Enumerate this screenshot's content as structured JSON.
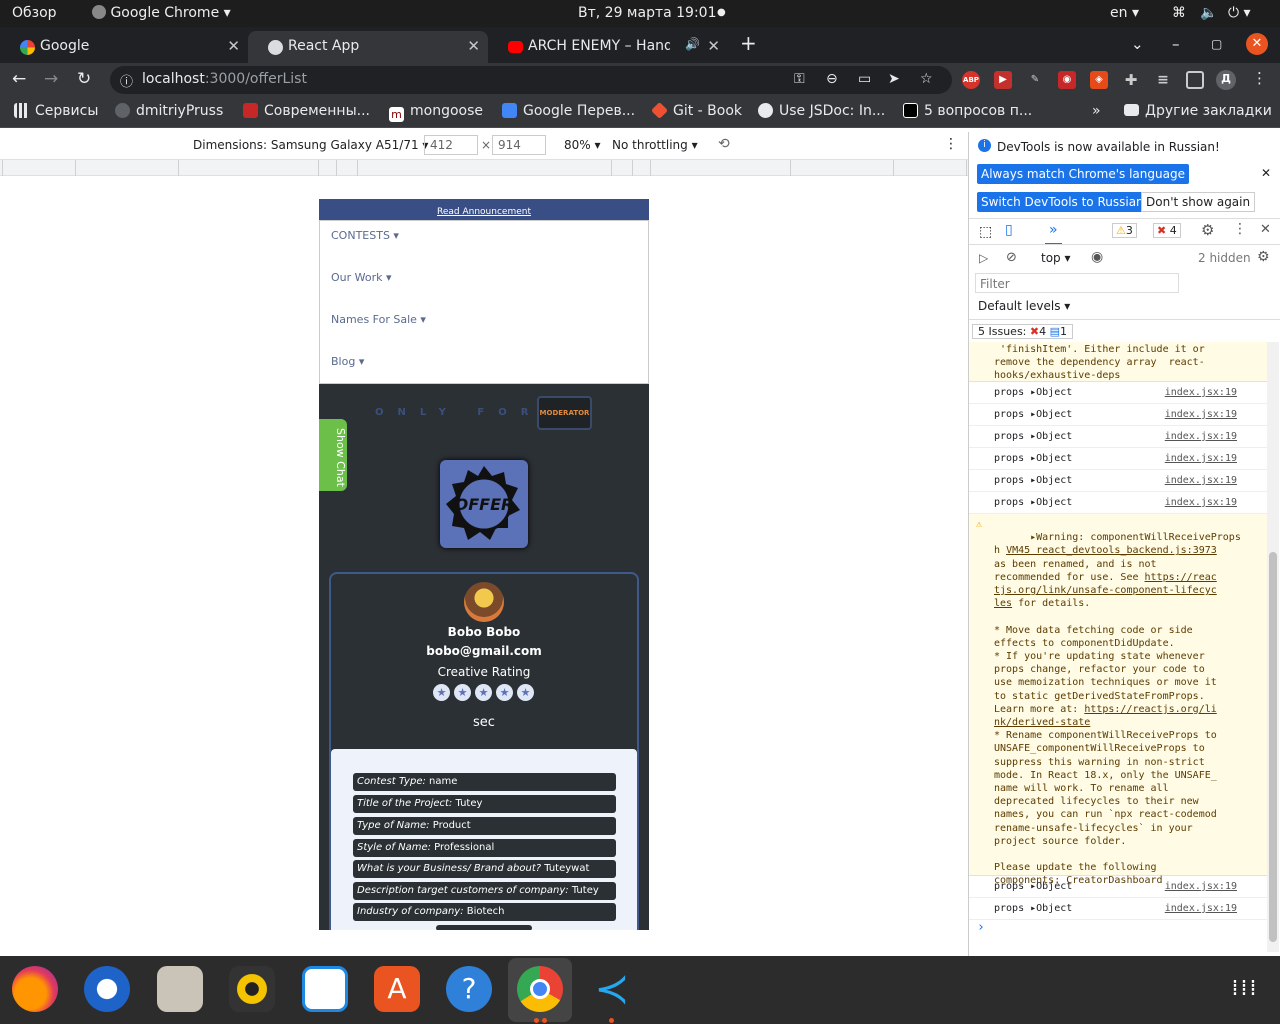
{
  "topbar": {
    "overview": "Обзор",
    "app": "Google Chrome",
    "datetime": "Вт, 29 марта  19:01",
    "lang": "en"
  },
  "tabs": [
    {
      "title": "Google"
    },
    {
      "title": "React App"
    },
    {
      "title": "ARCH ENEMY – Hands"
    }
  ],
  "address": {
    "host": "localhost",
    "path": ":3000/offerList"
  },
  "extensions": {
    "abp": "ABP",
    "profile": "Д"
  },
  "bookmarks": [
    {
      "label": "Сервисы"
    },
    {
      "label": "dmitriyPruss"
    },
    {
      "label": "Современны..."
    },
    {
      "label": "mongoose"
    },
    {
      "label": "Google Перев..."
    },
    {
      "label": "Git - Book"
    },
    {
      "label": "Use JSDoc: In..."
    },
    {
      "label": "5 вопросов п..."
    }
  ],
  "bookmarks_more": "»",
  "bookmarks_other": "Другие закладки",
  "device_toolbar": {
    "dimensions_label": "Dimensions: Samsung Galaxy A51/71",
    "width": "412",
    "x": "×",
    "height": "914",
    "zoom": "80%",
    "throttling": "No throttling"
  },
  "app": {
    "announcement": "Read Announcement",
    "menu": [
      "CONTESTS",
      "Our Work",
      "Names For Sale",
      "Blog"
    ],
    "only_for": "ONLY FOR",
    "moderator_badge": "MODERATOR",
    "show_chat": "Show Chat",
    "offer_badge": "OFFER",
    "creator": {
      "name": "Bobo Bobo",
      "email": "bobo@gmail.com",
      "rating_label": "Creative Rating",
      "rating_stars": 5,
      "timer": "sec"
    },
    "contest_info": [
      {
        "label": "Contest Type:",
        "value": "name"
      },
      {
        "label": "Title of the Project:",
        "value": "Tutey"
      },
      {
        "label": "Type of Name:",
        "value": "Product"
      },
      {
        "label": "Style of Name:",
        "value": "Professional"
      },
      {
        "label": "What is your Business/ Brand about?",
        "value": "Tuteywat"
      },
      {
        "label": "Description target customers of company:",
        "value": "Tutey"
      },
      {
        "label": "Industry of company:",
        "value": "Biotech"
      }
    ]
  },
  "devtools": {
    "notice": "DevTools is now available in Russian!",
    "btn_match": "Always match Chrome's language",
    "btn_switch": "Switch DevTools to Russian",
    "btn_dont_show": "Don't show again",
    "warn_count": "3",
    "error_count": "4",
    "context": "top",
    "hidden": "2 hidden",
    "filter_placeholder": "Filter",
    "levels": "Default levels",
    "issues_label": "5 Issues:",
    "issues_errors": "4",
    "issues_info": "1",
    "console_top_text": " 'finishItem'. Either include it or\nremove the dependency array  react-\nhooks/exhaustive-deps",
    "props_rows": [
      {
        "text": "props ▸Object",
        "src": "index.jsx:19"
      },
      {
        "text": "props ▸Object",
        "src": "index.jsx:19"
      },
      {
        "text": "props ▸Object",
        "src": "index.jsx:19"
      },
      {
        "text": "props ▸Object",
        "src": "index.jsx:19"
      },
      {
        "text": "props ▸Object",
        "src": "index.jsx:19"
      },
      {
        "text": "props ▸Object",
        "src": "index.jsx:19"
      }
    ],
    "warning_head": "▸Warning: componentWillReceiveProps\nh",
    "warning_link1": "VM45 react_devtools_backend.js:3973",
    "warning_body1": "as been renamed, and is not\nrecommended for use. See ",
    "warning_link2": "https://reac\ntjs.org/link/unsafe-component-lifecyc\nles",
    "warning_body2": " for details.\n\n* Move data fetching code or side\neffects to componentDidUpdate.\n* If you're updating state whenever\nprops change, refactor your code to\nuse memoization techniques or move it\nto static getDerivedStateFromProps.\nLearn more at: ",
    "warning_link3": "https://reactjs.org/li\nnk/derived-state",
    "warning_body3": "\n* Rename componentWillReceiveProps to\nUNSAFE_componentWillReceiveProps to\nsuppress this warning in non-strict\nmode. In React 18.x, only the UNSAFE_\nname will work. To rename all\ndeprecated lifecycles to their new\nnames, you can run `npx react-codemod\nrename-unsafe-lifecycles` in your\nproject source folder.\n\nPlease update the following\ncomponents: CreatorDashboard",
    "props_rows_after": [
      {
        "text": "props ▸Object",
        "src": "index.jsx:19"
      },
      {
        "text": "props ▸Object",
        "src": "index.jsx:19"
      }
    ],
    "prompt": "›"
  },
  "colors": {
    "accent": "#1a73e8",
    "chrome_dark": "#35363a",
    "app_dark": "#2b3034",
    "app_blue": "#3a4e86",
    "ubuntu_orange": "#e95420"
  }
}
